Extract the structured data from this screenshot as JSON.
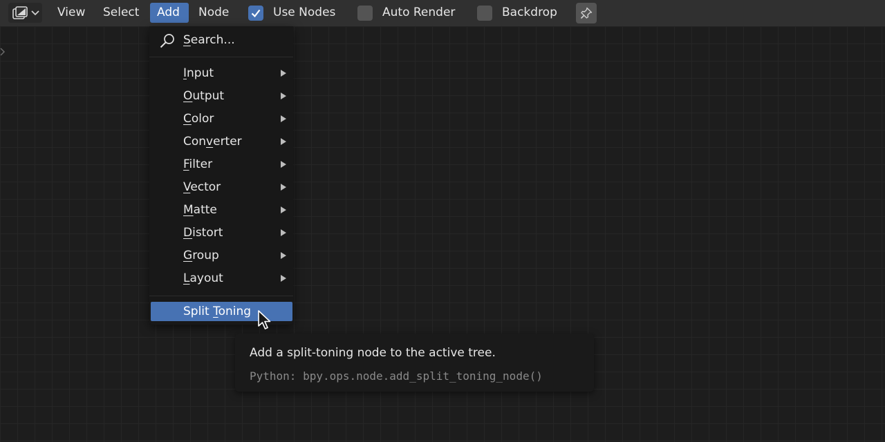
{
  "header": {
    "menu": [
      {
        "label": "View"
      },
      {
        "label": "Select"
      },
      {
        "label": "Add",
        "active": true
      },
      {
        "label": "Node"
      }
    ],
    "toggles": [
      {
        "label": "Use Nodes",
        "checked": true
      },
      {
        "label": "Auto Render",
        "checked": false
      },
      {
        "label": "Backdrop",
        "checked": false
      }
    ],
    "editor_type_icon": "compositor-icon",
    "pin_icon": "pin-icon"
  },
  "add_menu": {
    "search": {
      "first": "S",
      "rest": "earch..."
    },
    "items": [
      {
        "first": "I",
        "rest": "nput",
        "submenu": true
      },
      {
        "first": "O",
        "rest": "utput",
        "submenu": true
      },
      {
        "first": "C",
        "rest": "olor",
        "submenu": true
      },
      {
        "pre": "Con",
        "first": "v",
        "rest": "erter",
        "submenu": true
      },
      {
        "first": "F",
        "rest": "ilter",
        "submenu": true
      },
      {
        "first": "V",
        "rest": "ector",
        "submenu": true
      },
      {
        "first": "M",
        "rest": "atte",
        "submenu": true
      },
      {
        "first": "D",
        "rest": "istort",
        "submenu": true
      },
      {
        "first": "G",
        "rest": "roup",
        "submenu": true
      },
      {
        "first": "L",
        "rest": "ayout",
        "submenu": true
      }
    ],
    "highlighted": {
      "pre": "Split ",
      "first": "T",
      "rest": "oning"
    }
  },
  "tooltip": {
    "description": "Add a split-toning node to the active tree.",
    "python": "Python: bpy.ops.node.add_split_toning_node()"
  },
  "colors": {
    "accent": "#4772b3",
    "header_bg": "#303030",
    "menu_bg": "#181818",
    "canvas_bg": "#1d1d1d"
  }
}
